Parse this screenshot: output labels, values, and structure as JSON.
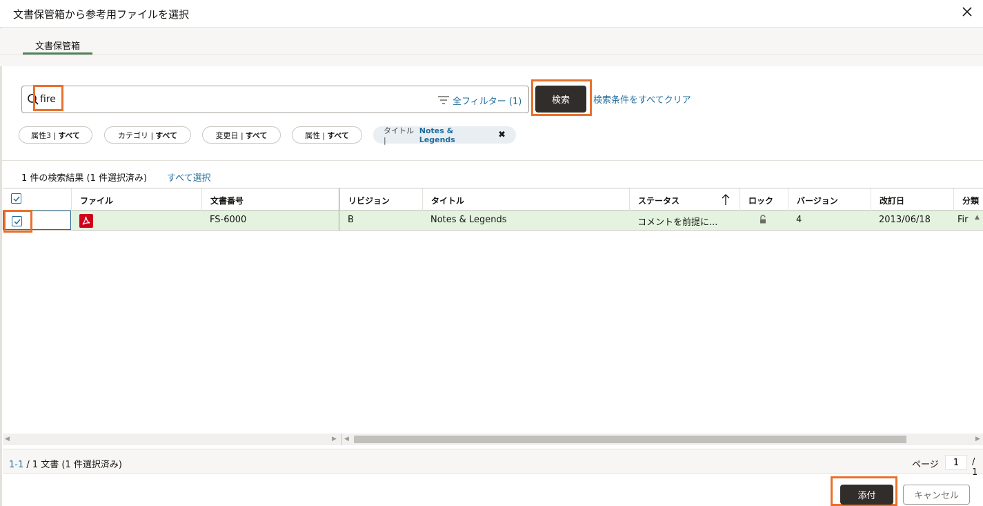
{
  "dialog": {
    "title": "文書保管箱から参考用ファイルを選択",
    "close_icon": "close-icon"
  },
  "tabs": [
    {
      "label": "文書保管箱",
      "selected": true
    }
  ],
  "search": {
    "value": "fire",
    "placeholder": "",
    "filter_label": "全フィルター (1)",
    "search_button": "検索",
    "clear_link": "検索条件をすべてクリア"
  },
  "chips": [
    {
      "label": "属性3 | ",
      "value": "すべて"
    },
    {
      "label": "カテゴリ | ",
      "value": "すべて"
    },
    {
      "label": "変更日 | ",
      "value": "すべて"
    },
    {
      "label": "属性 | ",
      "value": "すべて"
    },
    {
      "label": "タイトル | ",
      "value": "Notes & Legends",
      "active": true
    }
  ],
  "results": {
    "summary": "1 件の検索結果 (1 件選択済み)",
    "select_all": "すべて選択"
  },
  "grid": {
    "columns": [
      "ファイル",
      "文書番号",
      "リビジョン",
      "タイトル",
      "ステータス",
      "ロック",
      "バージョン",
      "改訂日",
      "分類"
    ],
    "rows": [
      {
        "checked": true,
        "file_icon": "pdf-icon",
        "doc_number": "FS-6000",
        "revision": "B",
        "title": "Notes & Legends",
        "status": "コメントを前提に...",
        "lock_icon": "unlock-icon",
        "version": "4",
        "revised": "2013/06/18",
        "category": "Fir"
      }
    ]
  },
  "footer": {
    "range_link": "1-1",
    "range_text": " / 1 文書  (1 件選択済み)",
    "page_label": "ページ",
    "page_value": "1",
    "page_total": "/ 1"
  },
  "actions": {
    "attach": "添付",
    "cancel": "キャンセル"
  },
  "colors": {
    "accent": "#1f6c9c",
    "highlight": "#e8712b",
    "selected_row": "#e4f3df",
    "tab_underline": "#4c825c",
    "primary_button": "#312d2a",
    "pdf_red": "#d0021b"
  }
}
